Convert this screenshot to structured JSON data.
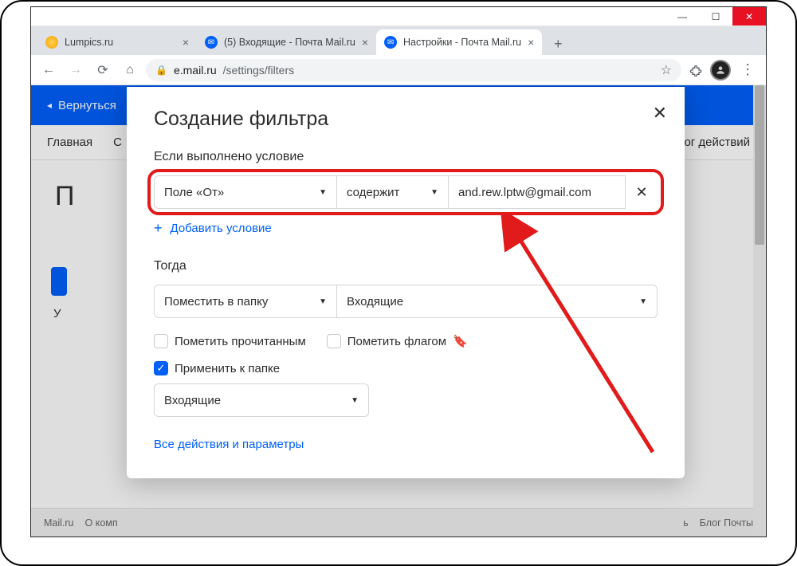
{
  "window": {
    "tabs": [
      {
        "title": "Lumpics.ru"
      },
      {
        "title": "(5) Входящие - Почта Mail.ru"
      },
      {
        "title": "Настройки - Почта Mail.ru"
      }
    ],
    "url_domain": "e.mail.ru",
    "url_path": "/settings/filters"
  },
  "background": {
    "back_link": "Вернуться",
    "nav_left": "Главная",
    "nav_left2": "С",
    "nav_right": "Лог действий",
    "page_header_initial": "П",
    "below_text": "У",
    "footer_left1": "Mail.ru",
    "footer_left2": "О комп",
    "footer_right1": "ь",
    "footer_right2": "Блог Почты"
  },
  "modal": {
    "title": "Создание фильтра",
    "section_condition": "Если выполнено условие",
    "condition": {
      "field_select": "Поле «От»",
      "operator_select": "содержит",
      "value_input": "and.rew.lptw@gmail.com"
    },
    "add_condition": "Добавить условие",
    "section_then": "Тогда",
    "action": {
      "action_select": "Поместить в папку",
      "folder_select": "Входящие"
    },
    "checkbox_read": "Пометить прочитанным",
    "checkbox_flag": "Пометить флагом",
    "checkbox_apply": "Применить к папке",
    "apply_folder": "Входящие",
    "all_actions_link": "Все действия и параметры"
  }
}
